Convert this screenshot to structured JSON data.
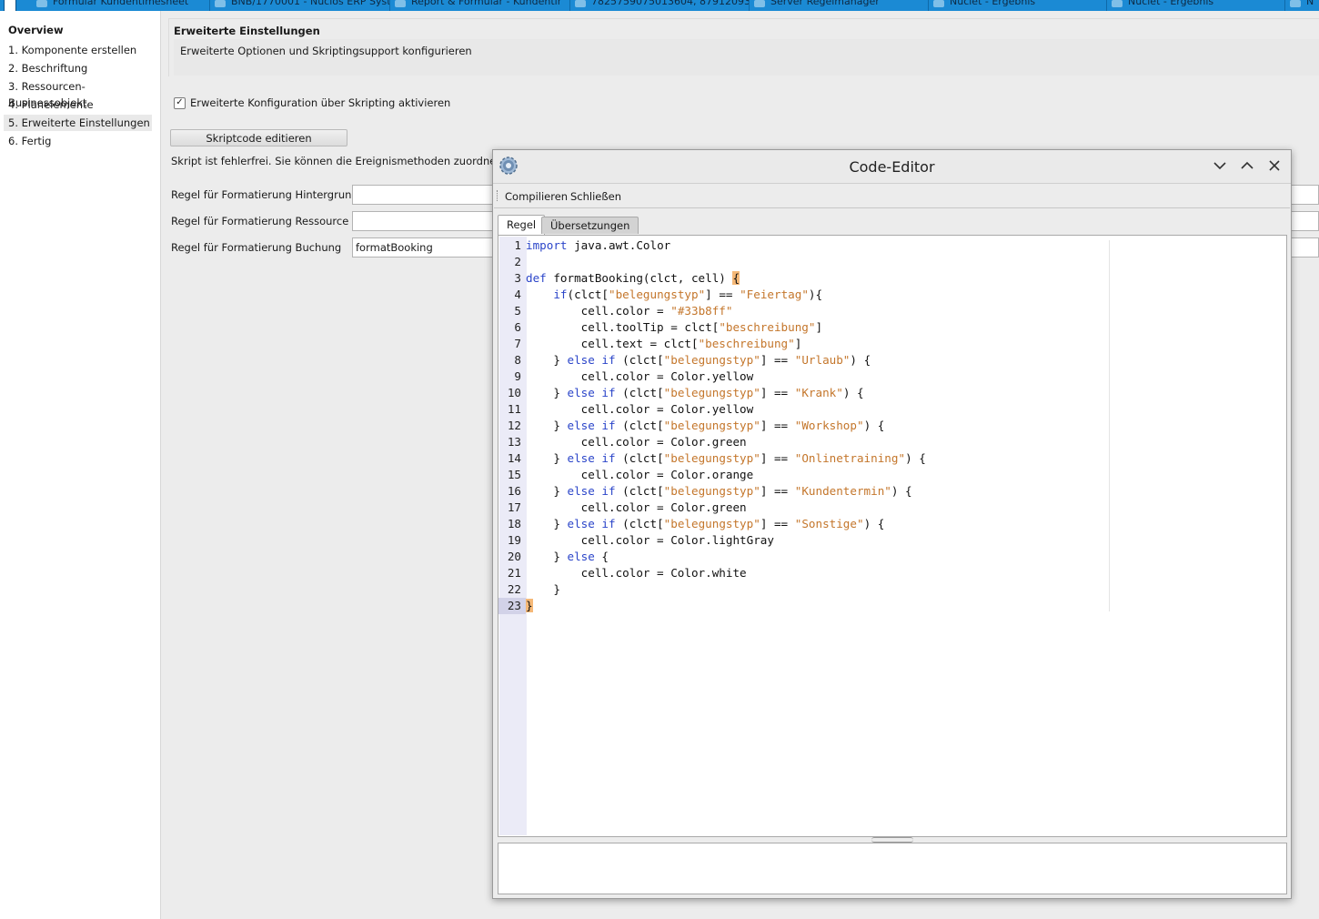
{
  "taskbar": {
    "tabs": [
      {
        "label": "Formular Kundentimesheet",
        "icon": "form-icon"
      },
      {
        "label": "BNB/1770001 - Nuclos ERP Syst",
        "icon": "clock-icon"
      },
      {
        "label": "Report & Formular - Kundentir",
        "icon": "report-icon"
      },
      {
        "label": "7825759075013604, 879120934",
        "icon": "user-icon"
      },
      {
        "label": "Server Regelmanager",
        "icon": "gear-icon"
      },
      {
        "label": "Nuclet - Ergebnis",
        "icon": "gear-icon"
      },
      {
        "label": "Nuclet - Ergebnis",
        "icon": "gear-icon"
      },
      {
        "label": "N",
        "icon": "gear-icon"
      }
    ]
  },
  "nav": {
    "title": "Overview",
    "steps": [
      "1. Komponente erstellen",
      "2. Beschriftung",
      "3. Ressourcen-Businessobjekt",
      "4. Planelemente",
      "5. Erweiterte Einstellungen",
      "6. Fertig"
    ],
    "active_index": 4
  },
  "header": {
    "title": "Erweiterte Einstellungen",
    "subtitle": "Erweiterte Optionen und Skriptingsupport konfigurieren"
  },
  "form": {
    "checkbox_label": "Erweiterte Konfiguration über Skripting aktivieren",
    "checkbox_checked": true,
    "edit_button": "Skriptcode editieren",
    "status_text": "Skript ist fehlerfrei. Sie können die Ereignismethoden zuordnen",
    "fields": [
      {
        "label": "Regel für Formatierung Hintergrund",
        "value": ""
      },
      {
        "label": "Regel für Formatierung Ressource",
        "value": ""
      },
      {
        "label": "Regel für Formatierung Buchung",
        "value": "formatBooking"
      }
    ]
  },
  "dialog": {
    "title": "Code-Editor",
    "menu": [
      "Compilieren",
      "Schließen"
    ],
    "tabs": [
      "Regel",
      "Übersetzungen"
    ],
    "active_tab": 0,
    "current_line": 23,
    "code_lines": [
      [
        {
          "t": "import",
          "c": "kw"
        },
        {
          "t": " java.awt.Color"
        }
      ],
      [],
      [
        {
          "t": "def",
          "c": "kw"
        },
        {
          "t": " formatBooking(clct, cell) "
        },
        {
          "t": "{",
          "c": "hl"
        }
      ],
      [
        {
          "t": "    "
        },
        {
          "t": "if",
          "c": "kw"
        },
        {
          "t": "(clct["
        },
        {
          "t": "\"belegungstyp\"",
          "c": "st"
        },
        {
          "t": "] == "
        },
        {
          "t": "\"Feiertag\"",
          "c": "st"
        },
        {
          "t": "){"
        }
      ],
      [
        {
          "t": "        cell.color = "
        },
        {
          "t": "\"#33b8ff\"",
          "c": "st"
        }
      ],
      [
        {
          "t": "        cell.toolTip = clct["
        },
        {
          "t": "\"beschreibung\"",
          "c": "st"
        },
        {
          "t": "]"
        }
      ],
      [
        {
          "t": "        cell.text = clct["
        },
        {
          "t": "\"beschreibung\"",
          "c": "st"
        },
        {
          "t": "]"
        }
      ],
      [
        {
          "t": "    } "
        },
        {
          "t": "else if",
          "c": "kw"
        },
        {
          "t": " (clct["
        },
        {
          "t": "\"belegungstyp\"",
          "c": "st"
        },
        {
          "t": "] == "
        },
        {
          "t": "\"Urlaub\"",
          "c": "st"
        },
        {
          "t": ") {"
        }
      ],
      [
        {
          "t": "        cell.color = Color.yellow"
        }
      ],
      [
        {
          "t": "    } "
        },
        {
          "t": "else if",
          "c": "kw"
        },
        {
          "t": " (clct["
        },
        {
          "t": "\"belegungstyp\"",
          "c": "st"
        },
        {
          "t": "] == "
        },
        {
          "t": "\"Krank\"",
          "c": "st"
        },
        {
          "t": ") {"
        }
      ],
      [
        {
          "t": "        cell.color = Color.yellow"
        }
      ],
      [
        {
          "t": "    } "
        },
        {
          "t": "else if",
          "c": "kw"
        },
        {
          "t": " (clct["
        },
        {
          "t": "\"belegungstyp\"",
          "c": "st"
        },
        {
          "t": "] == "
        },
        {
          "t": "\"Workshop\"",
          "c": "st"
        },
        {
          "t": ") {"
        }
      ],
      [
        {
          "t": "        cell.color = Color.green"
        }
      ],
      [
        {
          "t": "    } "
        },
        {
          "t": "else if",
          "c": "kw"
        },
        {
          "t": " (clct["
        },
        {
          "t": "\"belegungstyp\"",
          "c": "st"
        },
        {
          "t": "] == "
        },
        {
          "t": "\"Onlinetraining\"",
          "c": "st"
        },
        {
          "t": ") {"
        }
      ],
      [
        {
          "t": "        cell.color = Color.orange"
        }
      ],
      [
        {
          "t": "    } "
        },
        {
          "t": "else if",
          "c": "kw"
        },
        {
          "t": " (clct["
        },
        {
          "t": "\"belegungstyp\"",
          "c": "st"
        },
        {
          "t": "] == "
        },
        {
          "t": "\"Kundentermin\"",
          "c": "st"
        },
        {
          "t": ") {"
        }
      ],
      [
        {
          "t": "        cell.color = Color.green"
        }
      ],
      [
        {
          "t": "    } "
        },
        {
          "t": "else if",
          "c": "kw"
        },
        {
          "t": " (clct["
        },
        {
          "t": "\"belegungstyp\"",
          "c": "st"
        },
        {
          "t": "] == "
        },
        {
          "t": "\"Sonstige\"",
          "c": "st"
        },
        {
          "t": ") {"
        }
      ],
      [
        {
          "t": "        cell.color = Color.lightGray"
        }
      ],
      [
        {
          "t": "    } "
        },
        {
          "t": "else",
          "c": "kw"
        },
        {
          "t": " {"
        }
      ],
      [
        {
          "t": "        cell.color = Color.white"
        }
      ],
      [
        {
          "t": "    }"
        }
      ],
      [
        {
          "t": "}",
          "c": "hl"
        }
      ]
    ]
  },
  "colors": {
    "taskbar": "#1b8ad4",
    "keyword": "#2b45c9",
    "string": "#c4762b",
    "bracket_highlight": "#f5b877",
    "gutter": "#ebebf7"
  }
}
